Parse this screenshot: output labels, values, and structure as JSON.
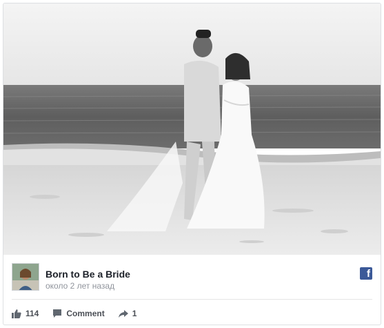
{
  "post": {
    "page_name": "Born to Be a Bride",
    "timestamp": "около 2 лет назад",
    "platform_icon": "facebook-icon",
    "photo_alt": "Black and white photo of a bride and groom embracing on a beach"
  },
  "actions": {
    "like_count": "114",
    "comment_label": "Comment",
    "share_count": "1"
  },
  "colors": {
    "facebook_blue": "#3b5998",
    "action_text": "#4b4f56",
    "meta_text": "#90949c"
  }
}
